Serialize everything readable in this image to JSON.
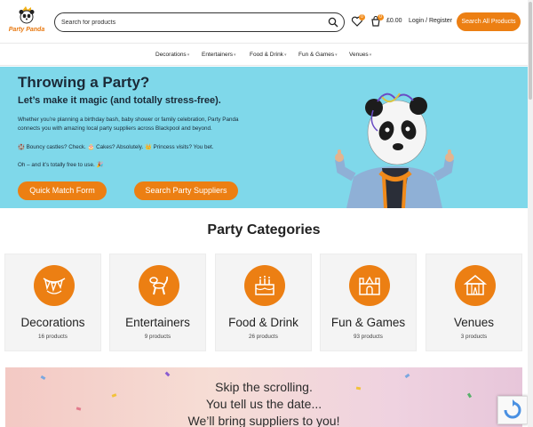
{
  "header": {
    "logo_text": "Party Panda",
    "search_placeholder": "Search for products",
    "wishlist_count": "0",
    "cart_count": "0",
    "cart_total": "£0.00",
    "login_label": "Login / Register",
    "search_all_label": "Search All Products"
  },
  "nav": {
    "items": [
      {
        "label": "Decorations",
        "has_dropdown": true
      },
      {
        "label": "Entertainers",
        "has_dropdown": true
      },
      {
        "label": "Food & Drink",
        "has_dropdown": true
      },
      {
        "label": "Fun & Games",
        "has_dropdown": true
      },
      {
        "label": "Venues",
        "has_dropdown": true
      }
    ]
  },
  "hero": {
    "title": "Throwing a Party?",
    "subtitle": "Let’s make it magic (and totally stress-free).",
    "body": "Whether you’re planning a birthday bash, baby shower or family celebration, Party Panda connects you with amazing local party suppliers across Blackpool and beyond.",
    "list_line": "🏰 Bouncy castles? Check.    🎂 Cakes? Absolutely.    👑 Princess visits? You bet.",
    "free_line": "Oh – and it’s totally free to use. 🎉",
    "quick_match_label": "Quick Match Form",
    "search_suppliers_label": "Search Party Suppliers"
  },
  "categories": {
    "title": "Party Categories",
    "items": [
      {
        "name": "Decorations",
        "count": "16 products",
        "icon": "bunting-icon"
      },
      {
        "name": "Entertainers",
        "count": "9 products",
        "icon": "balloon-dog-icon"
      },
      {
        "name": "Food & Drink",
        "count": "26 products",
        "icon": "cake-icon"
      },
      {
        "name": "Fun & Games",
        "count": "93 products",
        "icon": "bouncy-castle-icon"
      },
      {
        "name": "Venues",
        "count": "3 products",
        "icon": "tent-icon"
      }
    ]
  },
  "banner": {
    "line1": "Skip the scrolling.",
    "line2": "You tell us the date...",
    "line3": "We’ll bring suppliers to you!"
  },
  "colors": {
    "accent": "#ec7f13",
    "hero_bg": "#7fd8ea",
    "card_bg": "#f4f4f4"
  }
}
